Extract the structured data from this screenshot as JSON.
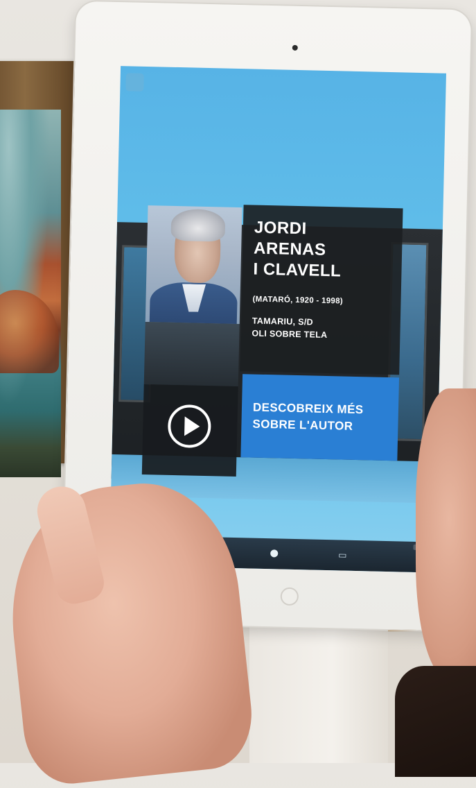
{
  "overlay": {
    "artist_name_lines": [
      "JORDI",
      "ARENAS",
      "I CLAVELL"
    ],
    "artist_dates": "(MATARÓ, 1920 - 1998)",
    "artwork_title": "TAMARIU, S/D",
    "artwork_medium": "OLI SOBRE TELA",
    "discover_lines": [
      "DESCOBREIX MÉS",
      "SOBRE L'AUTOR"
    ]
  },
  "colors": {
    "accent": "#2a7fd4",
    "panel": "#1c1f22",
    "screen_sky": "#5fbce9"
  },
  "icons": {
    "play": "play-icon",
    "toolbar": [
      "gallery-icon",
      "page-dot-icon",
      "window-icon"
    ]
  }
}
